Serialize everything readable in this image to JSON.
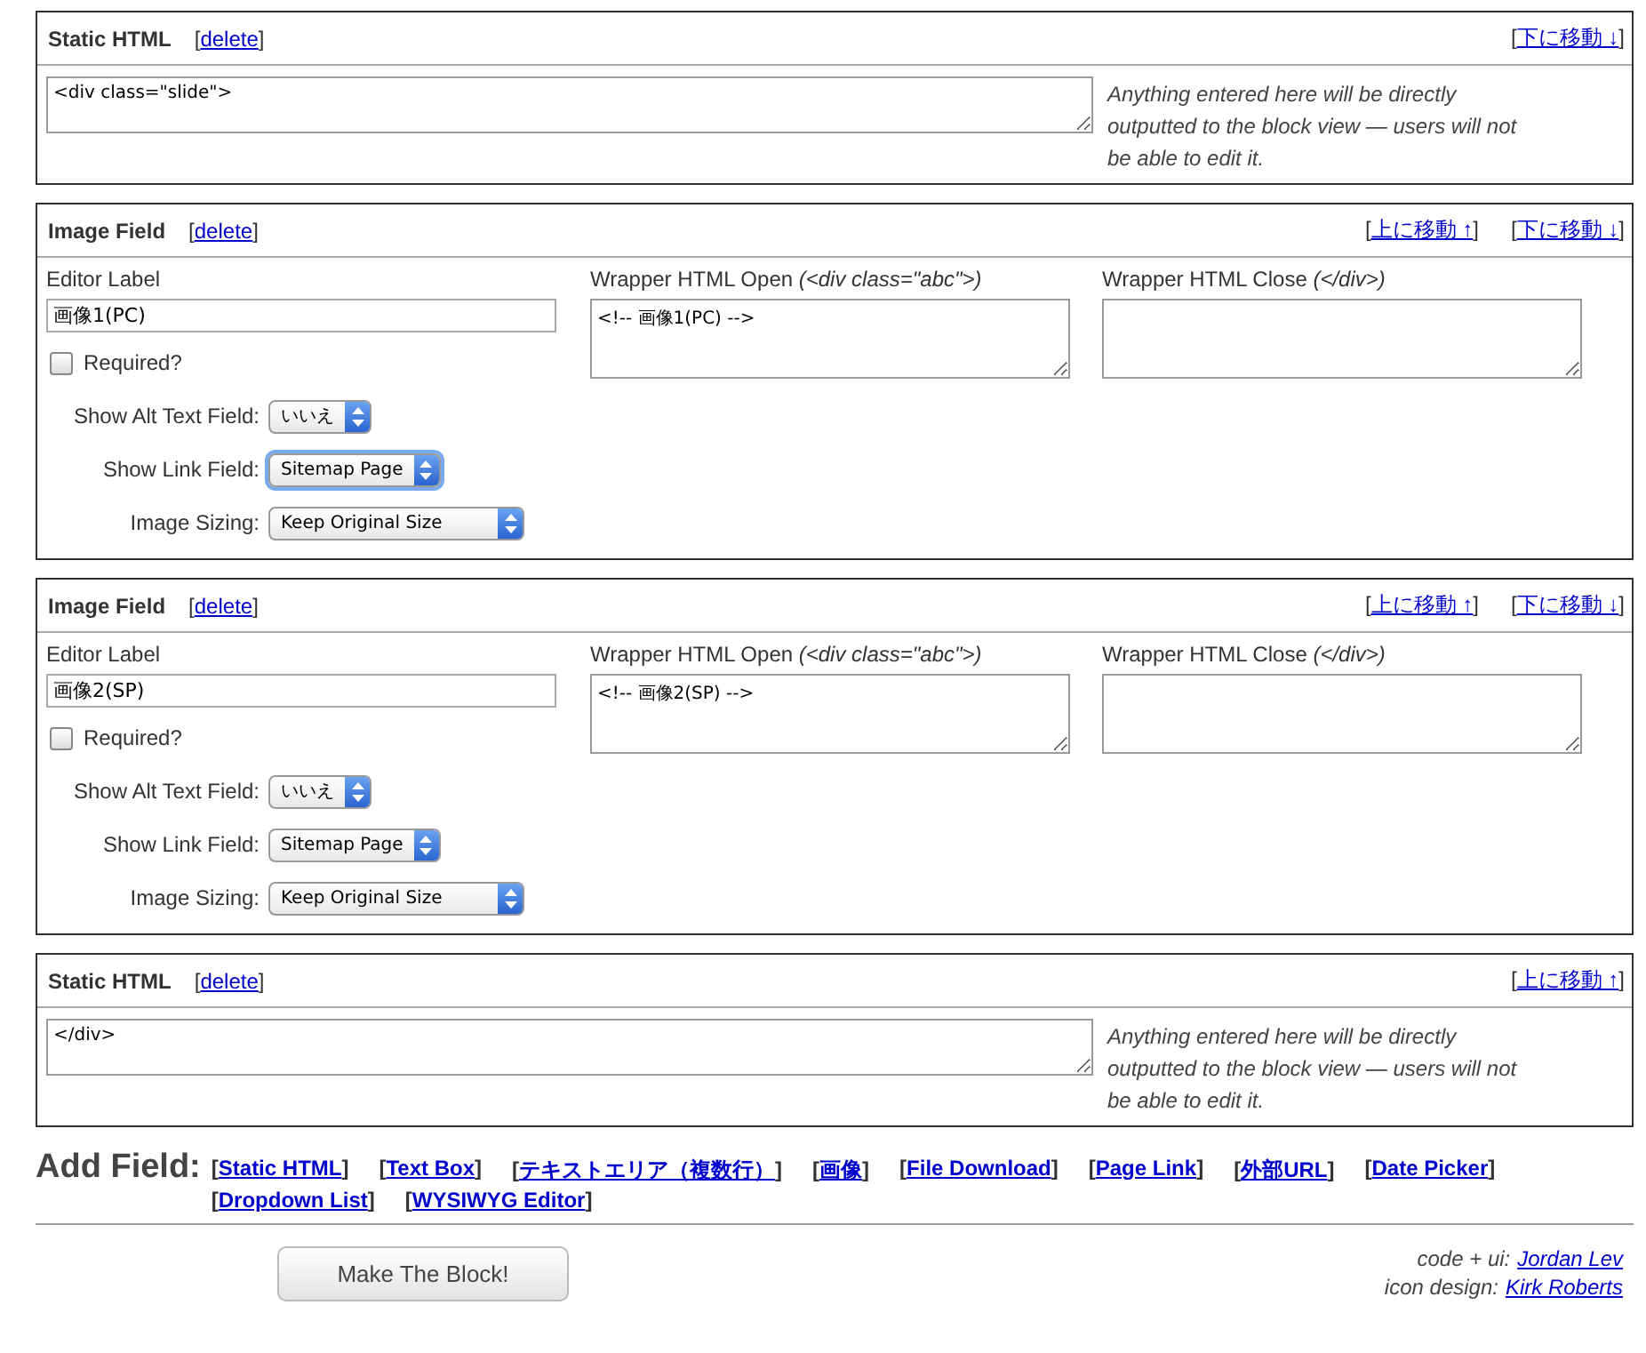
{
  "brackets": [
    "[",
    "]"
  ],
  "blocks": [
    {
      "kind": "static",
      "title": "Static HTML",
      "delete": "delete",
      "moves": [
        {
          "label": "下に移動 ↓"
        }
      ],
      "content": "<div class=\"slide\">",
      "note": "Anything entered here will be directly outputted to the block view — users will not be able to edit it."
    },
    {
      "kind": "image",
      "title": "Image Field",
      "delete": "delete",
      "moves": [
        {
          "label": "上に移動 ↑"
        },
        {
          "label": "下に移動 ↓"
        }
      ],
      "editor_label": {
        "label": "Editor Label",
        "value": "画像1(PC)"
      },
      "wrapper_open": {
        "label": "Wrapper HTML Open",
        "hint": "(<div class=\"abc\">)",
        "value": "<!-- 画像1(PC) -->"
      },
      "wrapper_close": {
        "label": "Wrapper HTML Close",
        "hint": "(</div>)"
      },
      "required": {
        "label": "Required?",
        "checked": false
      },
      "selects": [
        {
          "label": "Show Alt Text Field:",
          "value": "いいえ",
          "focused": false
        },
        {
          "label": "Show Link Field:",
          "value": "Sitemap Page",
          "focused": true
        },
        {
          "label": "Image Sizing:",
          "value": "Keep Original Size",
          "focused": false
        }
      ]
    },
    {
      "kind": "image",
      "title": "Image Field",
      "delete": "delete",
      "moves": [
        {
          "label": "上に移動 ↑"
        },
        {
          "label": "下に移動 ↓"
        }
      ],
      "editor_label": {
        "label": "Editor Label",
        "value": "画像2(SP)"
      },
      "wrapper_open": {
        "label": "Wrapper HTML Open",
        "hint": "(<div class=\"abc\">)",
        "value": "<!-- 画像2(SP) -->"
      },
      "wrapper_close": {
        "label": "Wrapper HTML Close",
        "hint": "(</div>)"
      },
      "required": {
        "label": "Required?",
        "checked": false
      },
      "selects": [
        {
          "label": "Show Alt Text Field:",
          "value": "いいえ",
          "focused": false
        },
        {
          "label": "Show Link Field:",
          "value": "Sitemap Page",
          "focused": false
        },
        {
          "label": "Image Sizing:",
          "value": "Keep Original Size",
          "focused": false
        }
      ]
    },
    {
      "kind": "static",
      "title": "Static HTML",
      "delete": "delete",
      "moves": [
        {
          "label": "上に移動 ↑"
        }
      ],
      "content": "</div>",
      "note": "Anything entered here will be directly outputted to the block view — users will not be able to edit it."
    }
  ],
  "add_field": {
    "label": "Add Field:",
    "links": [
      "Static HTML",
      "Text Box",
      "テキストエリア（複数行）",
      "画像",
      "File Download",
      "Page Link",
      "外部URL",
      "Date Picker",
      "Dropdown List",
      "WYSIWYG Editor"
    ]
  },
  "submit": "Make The Block!",
  "credits": [
    {
      "label": "code + ui:",
      "name": "Jordan Lev"
    },
    {
      "label": "icon design:",
      "name": "Kirk Roberts"
    }
  ]
}
